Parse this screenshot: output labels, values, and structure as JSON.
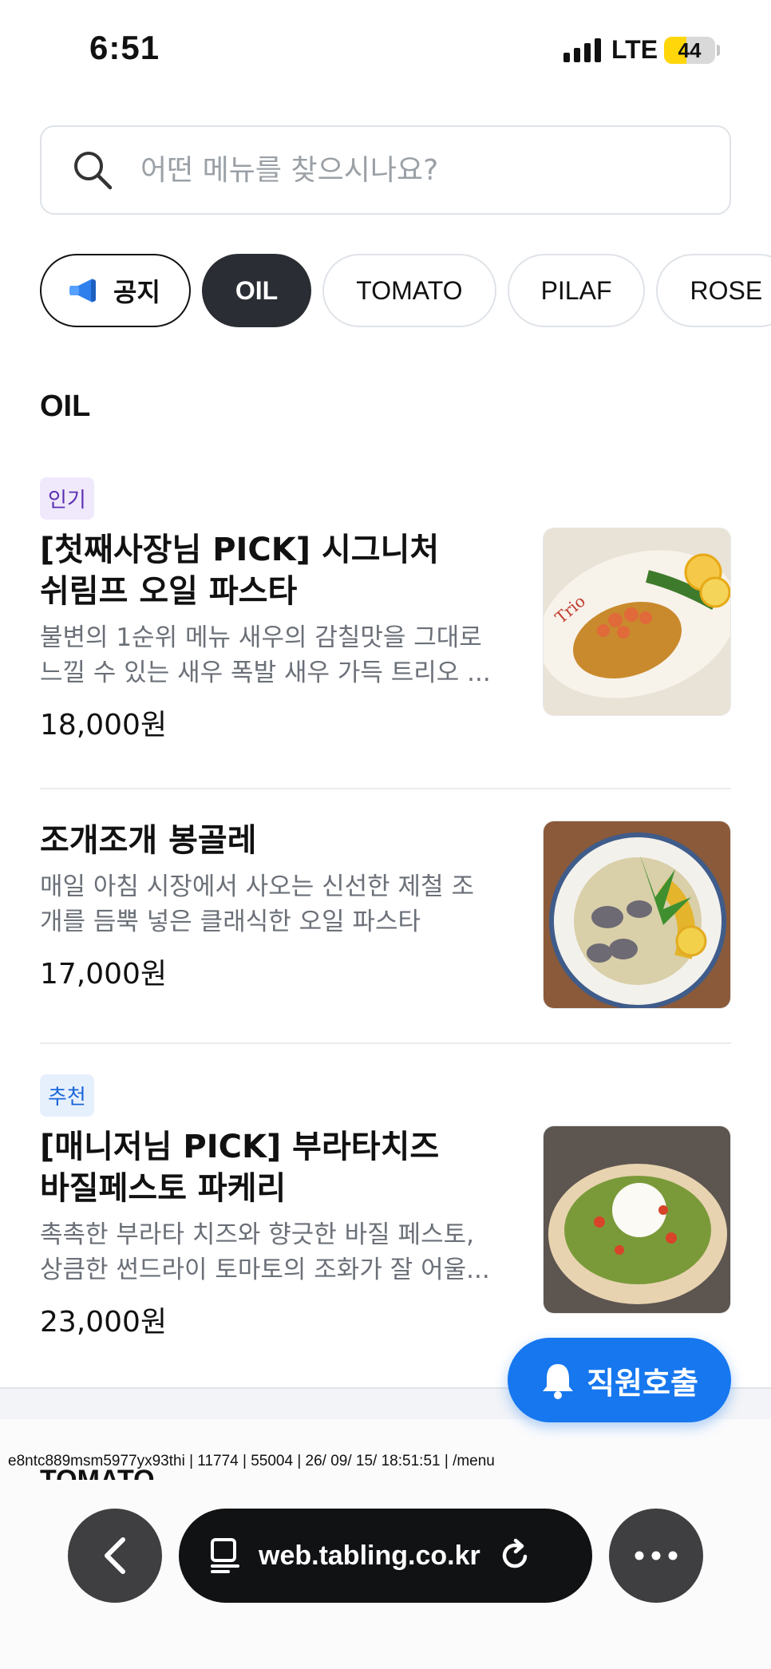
{
  "status_bar": {
    "time": "6:51",
    "network": "LTE",
    "battery": "44",
    "battery_level": 0.44
  },
  "search": {
    "placeholder": "어떤 메뉴를 찾으시나요?"
  },
  "categories": [
    {
      "label": "공지",
      "icon": "megaphone-icon",
      "type": "notice"
    },
    {
      "label": "OIL",
      "selected": true
    },
    {
      "label": "TOMATO"
    },
    {
      "label": "PILAF"
    },
    {
      "label": "ROSE"
    }
  ],
  "section_title": "OIL",
  "menu_items": [
    {
      "badge": "인기",
      "name_line1": "[첫째사장님 PICK] 시그니처",
      "name_line2": "쉬림프 오일 파스타",
      "desc_line1": "불변의 1순위 메뉴 새우의 감칠맛을 그대로",
      "desc_line2": "느낄 수 있는 새우 폭발 새우 가득 트리오 ...",
      "price": "18,000원"
    },
    {
      "badge": "",
      "name_line1": "조개조개 봉골레",
      "name_line2": "",
      "desc_line1": "매일 아침 시장에서 사오는 신선한  제철 조",
      "desc_line2": "개를 듬뿍 넣은 클래식한 오일 파스타",
      "price": "17,000원"
    },
    {
      "badge": "추천",
      "name_line1": "[매니저님 PICK] 부라타치즈",
      "name_line2": "바질페스토 파케리",
      "desc_line1": "촉촉한 부라타 치즈와 향긋한 바질 페스토,",
      "desc_line2": "상큼한 썬드라이 토마토의 조화가 잘 어울...",
      "price": "23,000원"
    }
  ],
  "staff_call": {
    "label": "직원호출",
    "icon": "bell-icon"
  },
  "debug_line": "e8ntc889msm5977yx93thi | 11774 | 55004 | 26/ 09/ 15/ 18:51:51 | /menu",
  "next_section_peek": "TOMATO",
  "browser": {
    "url": "web.tabling.co.kr"
  },
  "colors": {
    "accent": "#1677ef",
    "chip_active": "#2a2d33",
    "badge_popular": "#5b2fb3",
    "badge_recommend": "#1a66d9"
  }
}
